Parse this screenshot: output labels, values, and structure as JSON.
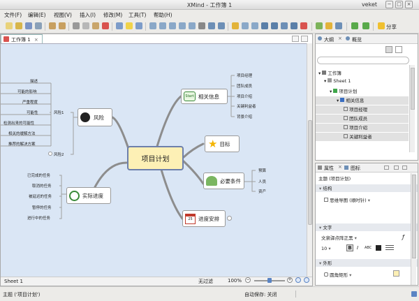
{
  "window": {
    "title": "XMind - 工作簿 1",
    "user": "veket"
  },
  "menu": [
    "文件(F)",
    "编辑(E)",
    "视图(V)",
    "插入(I)",
    "修改(M)",
    "工具(T)",
    "帮助(H)"
  ],
  "toolbar": {
    "share_label": "分享"
  },
  "editor": {
    "tab_label": "工作簿 1"
  },
  "mindmap": {
    "central": "项目计划",
    "branches": {
      "related": "相关信息",
      "goal": "目标",
      "resources": "必要条件",
      "schedule": "进度安排",
      "progress": "实际进度",
      "risk": "风险"
    },
    "related_items": [
      "项目经理",
      "团队成员",
      "项目介绍",
      "关键利益者",
      "背景介绍"
    ],
    "resources_items": [
      "预算",
      "人员",
      "资产"
    ],
    "progress_items": [
      "已完成的任务",
      "取消的任务",
      "被延迟的任务",
      "暂停的任务",
      "进行中的任务"
    ],
    "risk_groups": [
      "风险1",
      "风险2"
    ],
    "risk1_items": [
      "描述",
      "可能的影响",
      "严重程度",
      "可能性",
      "检测出来的可能性",
      "相关的缓解方法",
      "推荐的解决方案"
    ]
  },
  "sheet_tab": "Sheet 1",
  "canvas_status": {
    "filter": "无过滤",
    "zoom": "100%"
  },
  "outline": {
    "tab_outline": "大纲",
    "tab_overview": "概览",
    "items": [
      "工作簿",
      "Sheet 1",
      "项目计划",
      "相关信息",
      "项目经理",
      "团队成员",
      "项目介绍",
      "关键利益者"
    ]
  },
  "properties": {
    "tab_props": "属性",
    "tab_icons": "图标",
    "subject": "主题 (项目计划)",
    "section_structure": "结构",
    "structure_value": "思维导图 (顺时针)",
    "section_text": "文字",
    "font_name": "文泉驿点阵正黑",
    "font_size": "10",
    "section_shape": "外形",
    "shape_value": "圆角矩形"
  },
  "statusbar": {
    "topic": "主题 ('项目计划')",
    "autosave": "自动保存: 关闭"
  }
}
